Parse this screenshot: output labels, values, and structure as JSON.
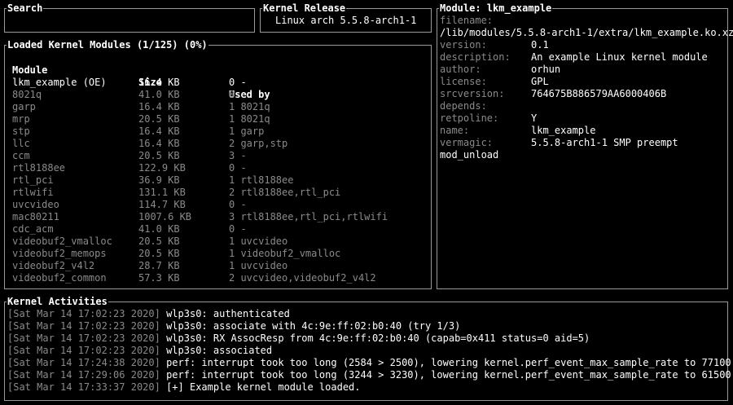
{
  "search": {
    "title": "Search",
    "value": ""
  },
  "kernel_release": {
    "title": "Kernel Release",
    "value": "Linux arch 5.5.8-arch1-1"
  },
  "modules_panel": {
    "title": "Loaded Kernel Modules (1/125) (0%)",
    "columns": [
      "Module",
      "Size",
      "Used by"
    ],
    "rows": [
      {
        "name": "lkm_example (OE)",
        "size": "16.4 KB",
        "used": "0 -",
        "selected": true
      },
      {
        "name": "8021q",
        "size": "41.0 KB",
        "used": "0 -"
      },
      {
        "name": "garp",
        "size": "16.4 KB",
        "used": "1 8021q"
      },
      {
        "name": "mrp",
        "size": "20.5 KB",
        "used": "1 8021q"
      },
      {
        "name": "stp",
        "size": "16.4 KB",
        "used": "1 garp"
      },
      {
        "name": "llc",
        "size": "16.4 KB",
        "used": "2 garp,stp"
      },
      {
        "name": "ccm",
        "size": "20.5 KB",
        "used": "3 -"
      },
      {
        "name": "rtl8188ee",
        "size": "122.9 KB",
        "used": "0 -"
      },
      {
        "name": "rtl_pci",
        "size": "36.9 KB",
        "used": "1 rtl8188ee"
      },
      {
        "name": "rtlwifi",
        "size": "131.1 KB",
        "used": "2 rtl8188ee,rtl_pci"
      },
      {
        "name": "uvcvideo",
        "size": "114.7 KB",
        "used": "0 -"
      },
      {
        "name": "mac80211",
        "size": "1007.6 KB",
        "used": "3 rtl8188ee,rtl_pci,rtlwifi"
      },
      {
        "name": "cdc_acm",
        "size": "41.0 KB",
        "used": "0 -"
      },
      {
        "name": "videobuf2_vmalloc",
        "size": "20.5 KB",
        "used": "1 uvcvideo"
      },
      {
        "name": "videobuf2_memops",
        "size": "20.5 KB",
        "used": "1 videobuf2_vmalloc"
      },
      {
        "name": "videobuf2_v4l2",
        "size": "28.7 KB",
        "used": "1 uvcvideo"
      },
      {
        "name": "videobuf2_common",
        "size": "57.3 KB",
        "used": "2 uvcvideo,videobuf2_v4l2"
      }
    ]
  },
  "module_info": {
    "title": "Module: lkm_example",
    "fields": [
      {
        "key": "filename:",
        "value": ""
      },
      {
        "key": "",
        "value": "/lib/modules/5.5.8-arch1-1/extra/lkm_example.ko.xz"
      },
      {
        "key": "version:",
        "value": "0.1"
      },
      {
        "key": "description:",
        "value": "An example Linux kernel module"
      },
      {
        "key": "author:",
        "value": "orhun"
      },
      {
        "key": "license:",
        "value": "GPL"
      },
      {
        "key": "srcversion:",
        "value": "764675B886579AA6000406B"
      },
      {
        "key": "depends:",
        "value": ""
      },
      {
        "key": "retpoline:",
        "value": "Y"
      },
      {
        "key": "name:",
        "value": "lkm_example"
      },
      {
        "key": "vermagic:",
        "value": "5.5.8-arch1-1 SMP preempt"
      },
      {
        "key": "",
        "value": "mod_unload"
      }
    ]
  },
  "activities": {
    "title": "Kernel Activities",
    "lines": [
      {
        "time": "[Sat Mar 14 17:02:23 2020]",
        "msg": "wlp3s0: authenticated"
      },
      {
        "time": "[Sat Mar 14 17:02:23 2020]",
        "msg": "wlp3s0: associate with 4c:9e:ff:02:b0:40 (try 1/3)"
      },
      {
        "time": "[Sat Mar 14 17:02:23 2020]",
        "msg": "wlp3s0: RX AssocResp from 4c:9e:ff:02:b0:40 (capab=0x411 status=0 aid=5)"
      },
      {
        "time": "[Sat Mar 14 17:02:23 2020]",
        "msg": "wlp3s0: associated"
      },
      {
        "time": "[Sat Mar 14 17:24:38 2020]",
        "msg": "perf: interrupt took too long (2584 > 2500), lowering kernel.perf_event_max_sample_rate to 77100"
      },
      {
        "time": "[Sat Mar 14 17:29:06 2020]",
        "msg": "perf: interrupt took too long (3244 > 3230), lowering kernel.perf_event_max_sample_rate to 61500"
      },
      {
        "time": "[Sat Mar 14 17:33:37 2020]",
        "msg": "[+] Example kernel module loaded."
      }
    ]
  },
  "colors": {
    "border": "#9a9a9a",
    "dim": "#8a8a8a",
    "text": "#ffffff",
    "background": "#000000"
  }
}
